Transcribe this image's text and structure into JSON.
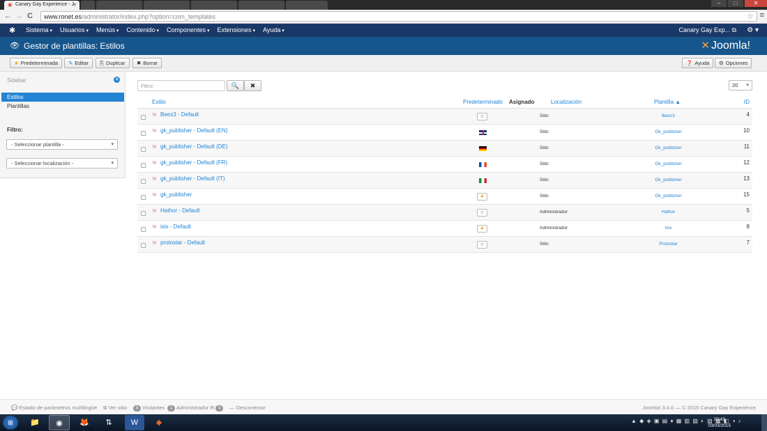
{
  "browser": {
    "tab_title": "Canary Gay Experience - J",
    "tab_close": "✕",
    "background_tabs": 6,
    "url_host": "www.ronet.es",
    "url_path": "/administrator/index.php?option=com_templates",
    "back_icon": "←",
    "forward_icon": "→",
    "reload_icon": "C",
    "bookmark_icon": "☆",
    "menu_icon": "≡",
    "window_minimize": "–",
    "window_maximize": "□",
    "window_close": "✕"
  },
  "topnav": {
    "logo_icon": "✱",
    "menus": [
      "Sistema",
      "Usuarios",
      "Menús",
      "Contenido",
      "Componentes",
      "Extensiones",
      "Ayuda"
    ],
    "site_link": "Canary Gay Exp... ⧉",
    "settings_icon": "⚙ ▾"
  },
  "header": {
    "eye_icon": "👁",
    "title": "Gestor de plantillas: Estilos",
    "brand_mark": "✕",
    "brand": "Joomla!"
  },
  "toolbar": {
    "default": {
      "icon": "★",
      "label": "Predeterminada"
    },
    "edit": {
      "icon": "✎",
      "label": "Editar"
    },
    "duplicate": {
      "icon": "⎘",
      "label": "Duplicar"
    },
    "delete": {
      "icon": "✖",
      "label": "Borrar"
    },
    "help": {
      "icon": "❓",
      "label": "Ayuda"
    },
    "options": {
      "icon": "⚙",
      "label": "Opciones"
    }
  },
  "sidebar": {
    "title": "Sidebar",
    "close_icon": "✕",
    "items": [
      {
        "label": "Estilos",
        "active": true
      },
      {
        "label": "Plantillas",
        "active": false
      }
    ],
    "filter_title": "Filtro:",
    "select_template": "- Seleccionar plantilla -",
    "select_location": "- Seleccionar localización -"
  },
  "search": {
    "placeholder": "Filtro:",
    "search_icon": "🔍",
    "clear_icon": "✖",
    "limit": "20"
  },
  "table": {
    "headers": {
      "style": "Estilo",
      "default": "Predeterminado",
      "assigned": "Asignado",
      "location": "Localización",
      "template": "Plantilla ▲",
      "id": "ID"
    },
    "rows": [
      {
        "name": "Beez3 - Default",
        "default": "star",
        "location": "Sitio",
        "template": "Beez3",
        "id": "4"
      },
      {
        "name": "gk_publisher - Default (EN)",
        "default": "flag-gb",
        "location": "Sitio",
        "template": "Gk_publisher",
        "id": "10"
      },
      {
        "name": "gk_publisher - Default (DE)",
        "default": "flag-de",
        "location": "Sitio",
        "template": "Gk_publisher",
        "id": "11"
      },
      {
        "name": "gk_publisher - Default (FR)",
        "default": "flag-fr",
        "location": "Sitio",
        "template": "Gk_publisher",
        "id": "12"
      },
      {
        "name": "gk_publisher - Default (IT)",
        "default": "flag-it",
        "location": "Sitio",
        "template": "Gk_publisher",
        "id": "13"
      },
      {
        "name": "gk_publisher",
        "default": "star-on",
        "location": "Sitio",
        "template": "Gk_publisher",
        "id": "15"
      },
      {
        "name": "Hathor - Default",
        "default": "star",
        "location": "Administrador",
        "template": "Hathor",
        "id": "5"
      },
      {
        "name": "isis - Default",
        "default": "star-on",
        "location": "Administrador",
        "template": "Isis",
        "id": "8"
      },
      {
        "name": "protostar - Default",
        "default": "star",
        "location": "Sitio",
        "template": "Protostar",
        "id": "7"
      }
    ]
  },
  "footer": {
    "multilang": "Estado de parámetros multilingüe",
    "view_site": "Ver sitio",
    "visitors_count": "0",
    "visitors": "Visitantes",
    "admins_count": "1",
    "admins": "Administrador",
    "messages_count": "0",
    "logout": "Desconectar",
    "version": "Joomla! 3.4.0 — © 2015 Canary Gay Experience"
  },
  "taskbar": {
    "start_icon": "⊞",
    "apps": [
      {
        "name": "explorer",
        "icon": "📁"
      },
      {
        "name": "chrome",
        "icon": "◉"
      },
      {
        "name": "firefox",
        "icon": "🦊"
      },
      {
        "name": "network",
        "icon": "⇅"
      },
      {
        "name": "word",
        "icon": "W"
      },
      {
        "name": "filezilla",
        "icon": "◆"
      }
    ],
    "tray_icons": "▲ ◆ ◈ ▣ ▤ ♦ ▦ ▥ ▧ ◐ ▨ ▩ ◧ ◑ ♪",
    "time": "20:43",
    "date": "03/03/2015"
  },
  "colors": {
    "topnav": "#1a3867",
    "header": "#17568c",
    "accent": "#2384d3"
  }
}
